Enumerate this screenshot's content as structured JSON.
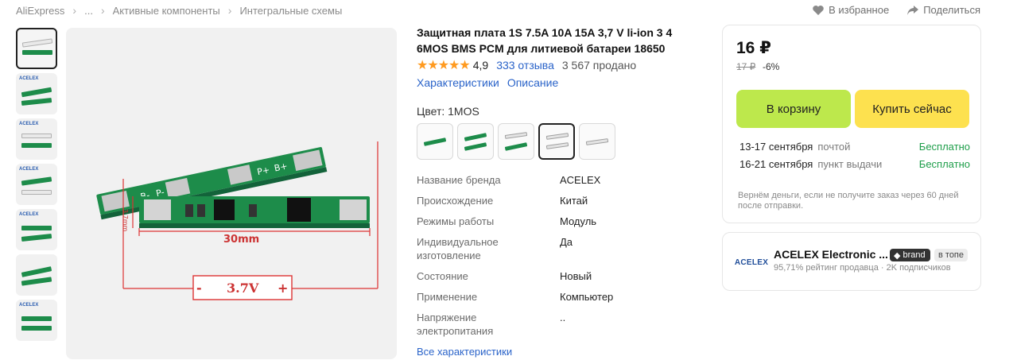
{
  "breadcrumb": [
    "AliExpress",
    "...",
    "Активные компоненты",
    "Интегральные схемы"
  ],
  "top_actions": {
    "favorite": "В избранное",
    "share": "Поделиться"
  },
  "image": {
    "board_labels": {
      "b_minus": "B-",
      "p_minus": "P-",
      "p_plus": "P+",
      "b_plus": "B+"
    },
    "dimension_height": "3.7mm",
    "dimension_width": "30mm",
    "battery_minus": "-",
    "battery_voltage": "3.7V",
    "battery_plus": "+",
    "thumb_brand": "ACELEX"
  },
  "product": {
    "title": "Защитная плата 1S 7.5A 10A 15A 3,7 V li-ion 3 4 6MOS BMS PCM для литиевой батареи 18650",
    "stars": "★★★★★",
    "rating": "4,9",
    "reviews": "333 отзыва",
    "sold": "3 567 продано",
    "tabs": [
      "Характеристики",
      "Описание"
    ],
    "color_label": "Цвет: 1MOS",
    "selected_variant": 4
  },
  "specs": [
    {
      "key": "Название бренда",
      "value": "ACELEX"
    },
    {
      "key": "Происхождение",
      "value": "Китай"
    },
    {
      "key": "Режимы работы",
      "value": "Модуль"
    },
    {
      "key": "Индивидуальное изготовление",
      "value": "Да"
    },
    {
      "key": "Состояние",
      "value": "Новый"
    },
    {
      "key": "Применение",
      "value": "Компьютер"
    },
    {
      "key": "Напряжение электропитания",
      "value": ".."
    }
  ],
  "all_specs_link": "Все характеристики",
  "buy": {
    "price": "16 ₽",
    "old_price": "17 ₽",
    "discount": "-6%",
    "cart_button": "В корзину",
    "buy_button": "Купить сейчас",
    "shipping": [
      {
        "date": "13-17 сентября",
        "method": "почтой",
        "cost": "Бесплатно"
      },
      {
        "date": "16-21 сентября",
        "method": "пункт выдачи",
        "cost": "Бесплатно"
      }
    ],
    "refund_note": "Вернём деньги, если не получите заказ через 60 дней после отправки."
  },
  "seller": {
    "logo": "ACELEX",
    "name": "ACELEX Electronic ...",
    "badge_brand": "brand",
    "badge_top": "в топе",
    "stats": "95,71% рейтинг продавца · 2K подписчиков"
  },
  "colors": {
    "accent_link": "#2a63c9",
    "cart_button": "#bde84c",
    "buy_button": "#fde14f",
    "free_shipping": "#1e9e4a",
    "stars": "#ff9a1f",
    "pcb_green": "#1d8c4a"
  }
}
